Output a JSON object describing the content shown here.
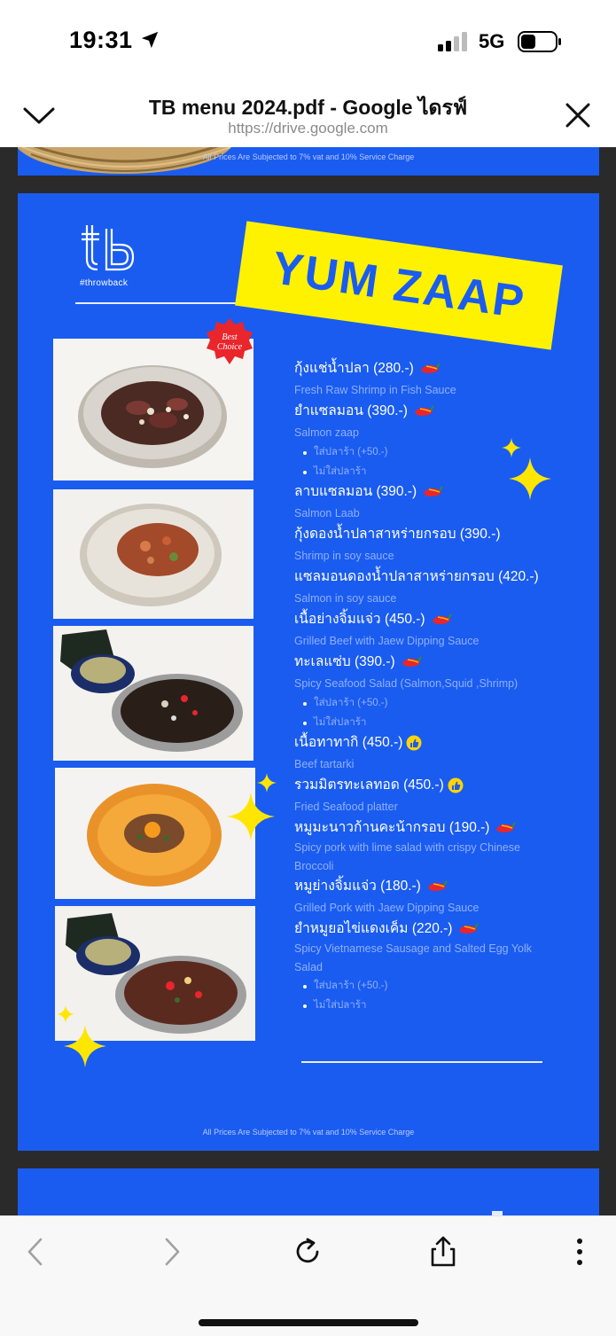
{
  "status_bar": {
    "time": "19:31",
    "network": "5G"
  },
  "header": {
    "title": "TB menu 2024.pdf - Google ไดรฟ์",
    "url": "https://drive.google.com"
  },
  "prev_page": {
    "footer": "All Prices Are Subjected to 7% vat and 10% Service Charge"
  },
  "menu_page": {
    "logo_text": "#throwback",
    "title": "YUM ZAAP",
    "badge": "Best Choice",
    "footer": "All Prices Are Subjected to 7% vat and 10% Service Charge",
    "items": [
      {
        "name": "กุ้งแช่น้ำปลา (280.-)",
        "desc": "Fresh Raw Shrimp in Fish Sauce",
        "mark": "chili"
      },
      {
        "name": "ยำแซลมอน (390.-)",
        "desc": "Salmon zaap",
        "mark": "chili",
        "options": [
          "ใส่ปลาร้า (+50.-)",
          "ไม่ใส่ปลาร้า"
        ]
      },
      {
        "name": "ลาบแซลมอน (390.-)",
        "desc": "Salmon Laab",
        "mark": "chili"
      },
      {
        "name": "กุ้งดองน้ำปลาสาหร่ายกรอบ (390.-)",
        "desc": "Shrimp in soy sauce",
        "mark": ""
      },
      {
        "name": "แซลมอนดองน้ำปลาสาหร่ายกรอบ (420.-)",
        "desc": "Salmon in soy sauce",
        "mark": ""
      },
      {
        "name": "เนื้อย่างจิ้มแจ่ว (450.-)",
        "desc": "Grilled Beef with Jaew Dipping Sauce",
        "mark": "chili"
      },
      {
        "name": "ทะเลแซ่บ (390.-)",
        "desc": "Spicy Seafood Salad (Salmon,Squid ,Shrimp)",
        "mark": "chili",
        "options": [
          "ใส่ปลาร้า (+50.-)",
          "ไม่ใส่ปลาร้า"
        ]
      },
      {
        "name": "เนื้อทาทากิ (450.-)",
        "desc": "Beef tartarki",
        "mark": "thumb"
      },
      {
        "name": "รวมมิตรทะเลทอด (450.-)",
        "desc": "Fried Seafood platter",
        "mark": "thumb"
      },
      {
        "name": "หมูมะนาวก้านคะน้ากรอบ (190.-)",
        "desc": "Spicy pork with lime salad with crispy Chinese Broccoli",
        "mark": "chili"
      },
      {
        "name": "หมูย่างจิ้มแจ่ว (180.-)",
        "desc": "Grilled Pork with Jaew Dipping Sauce",
        "mark": "chili"
      },
      {
        "name": "ยำหมูยอไข่แดงเค็ม (220.-)",
        "desc": "Spicy Vietnamese Sausage and Salted Egg Yolk Salad",
        "mark": "chili",
        "options": [
          "ใส่ปลาร้า (+50.-)",
          "ไม่ใส่ปลาร้า"
        ]
      }
    ]
  },
  "toolbar": {
    "buttons": [
      "back-icon",
      "forward-icon",
      "reload-icon",
      "share-icon",
      "more-icon"
    ]
  },
  "colors": {
    "page_blue": "#1a5cf0",
    "banner_yellow": "#fff200",
    "desc_blue": "#8fb0ff",
    "chili_red": "#e8262c",
    "sparkle_yellow": "#ffe600"
  }
}
